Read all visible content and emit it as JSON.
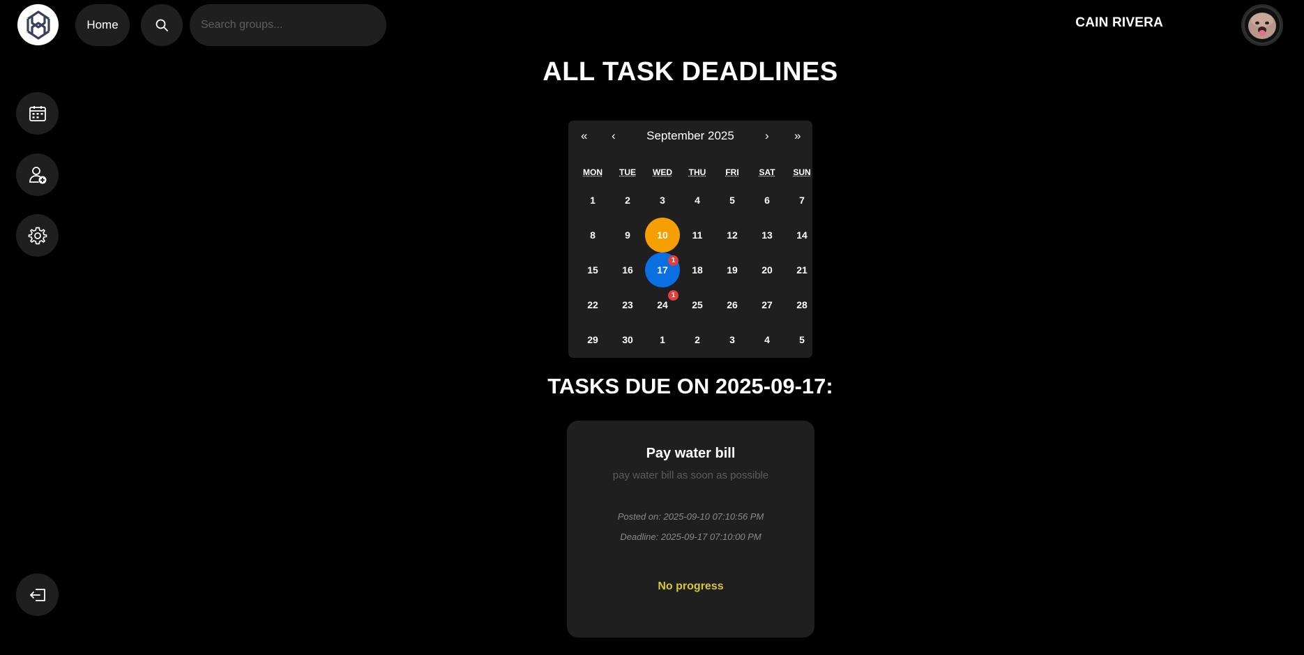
{
  "header": {
    "home_label": "Home",
    "search_placeholder": "Search groups...",
    "user_name": "CAIN RIVERA"
  },
  "icons": {
    "logo": "app-logo-icon",
    "search": "search-icon",
    "avatar": "user-avatar",
    "calendar": "calendar-icon",
    "add_user": "add-user-icon",
    "settings": "gear-icon",
    "logout": "logout-icon"
  },
  "page": {
    "title": "ALL TASK DEADLINES",
    "due_title": "TASKS DUE ON 2025-09-17:"
  },
  "calendar": {
    "month_label": "September 2025",
    "prev_year": "«",
    "prev_month": "‹",
    "next_month": "›",
    "next_year": "»",
    "weekdays": [
      "MON",
      "TUE",
      "WED",
      "THU",
      "FRI",
      "SAT",
      "SUN"
    ],
    "weeks": [
      [
        "1",
        "2",
        "3",
        "4",
        "5",
        "6",
        "7"
      ],
      [
        "8",
        "9",
        "10",
        "11",
        "12",
        "13",
        "14"
      ],
      [
        "15",
        "16",
        "17",
        "18",
        "19",
        "20",
        "21"
      ],
      [
        "22",
        "23",
        "24",
        "25",
        "26",
        "27",
        "28"
      ],
      [
        "29",
        "30",
        "1",
        "2",
        "3",
        "4",
        "5"
      ]
    ],
    "today": "10",
    "selected": "17",
    "today_color": "#f5a000",
    "selected_color": "#0a6fe0",
    "badge_color": "#e0413b",
    "badges": [
      {
        "day": "17",
        "count": "1"
      },
      {
        "day": "24",
        "count": "1"
      }
    ]
  },
  "task": {
    "title": "Pay water bill",
    "description": "pay water bill as soon as possible",
    "posted": "Posted on: 2025-09-10 07:10:56 PM",
    "deadline": "Deadline: 2025-09-17 07:10:00 PM",
    "status": "No progress",
    "status_color": "#d8c63a"
  }
}
